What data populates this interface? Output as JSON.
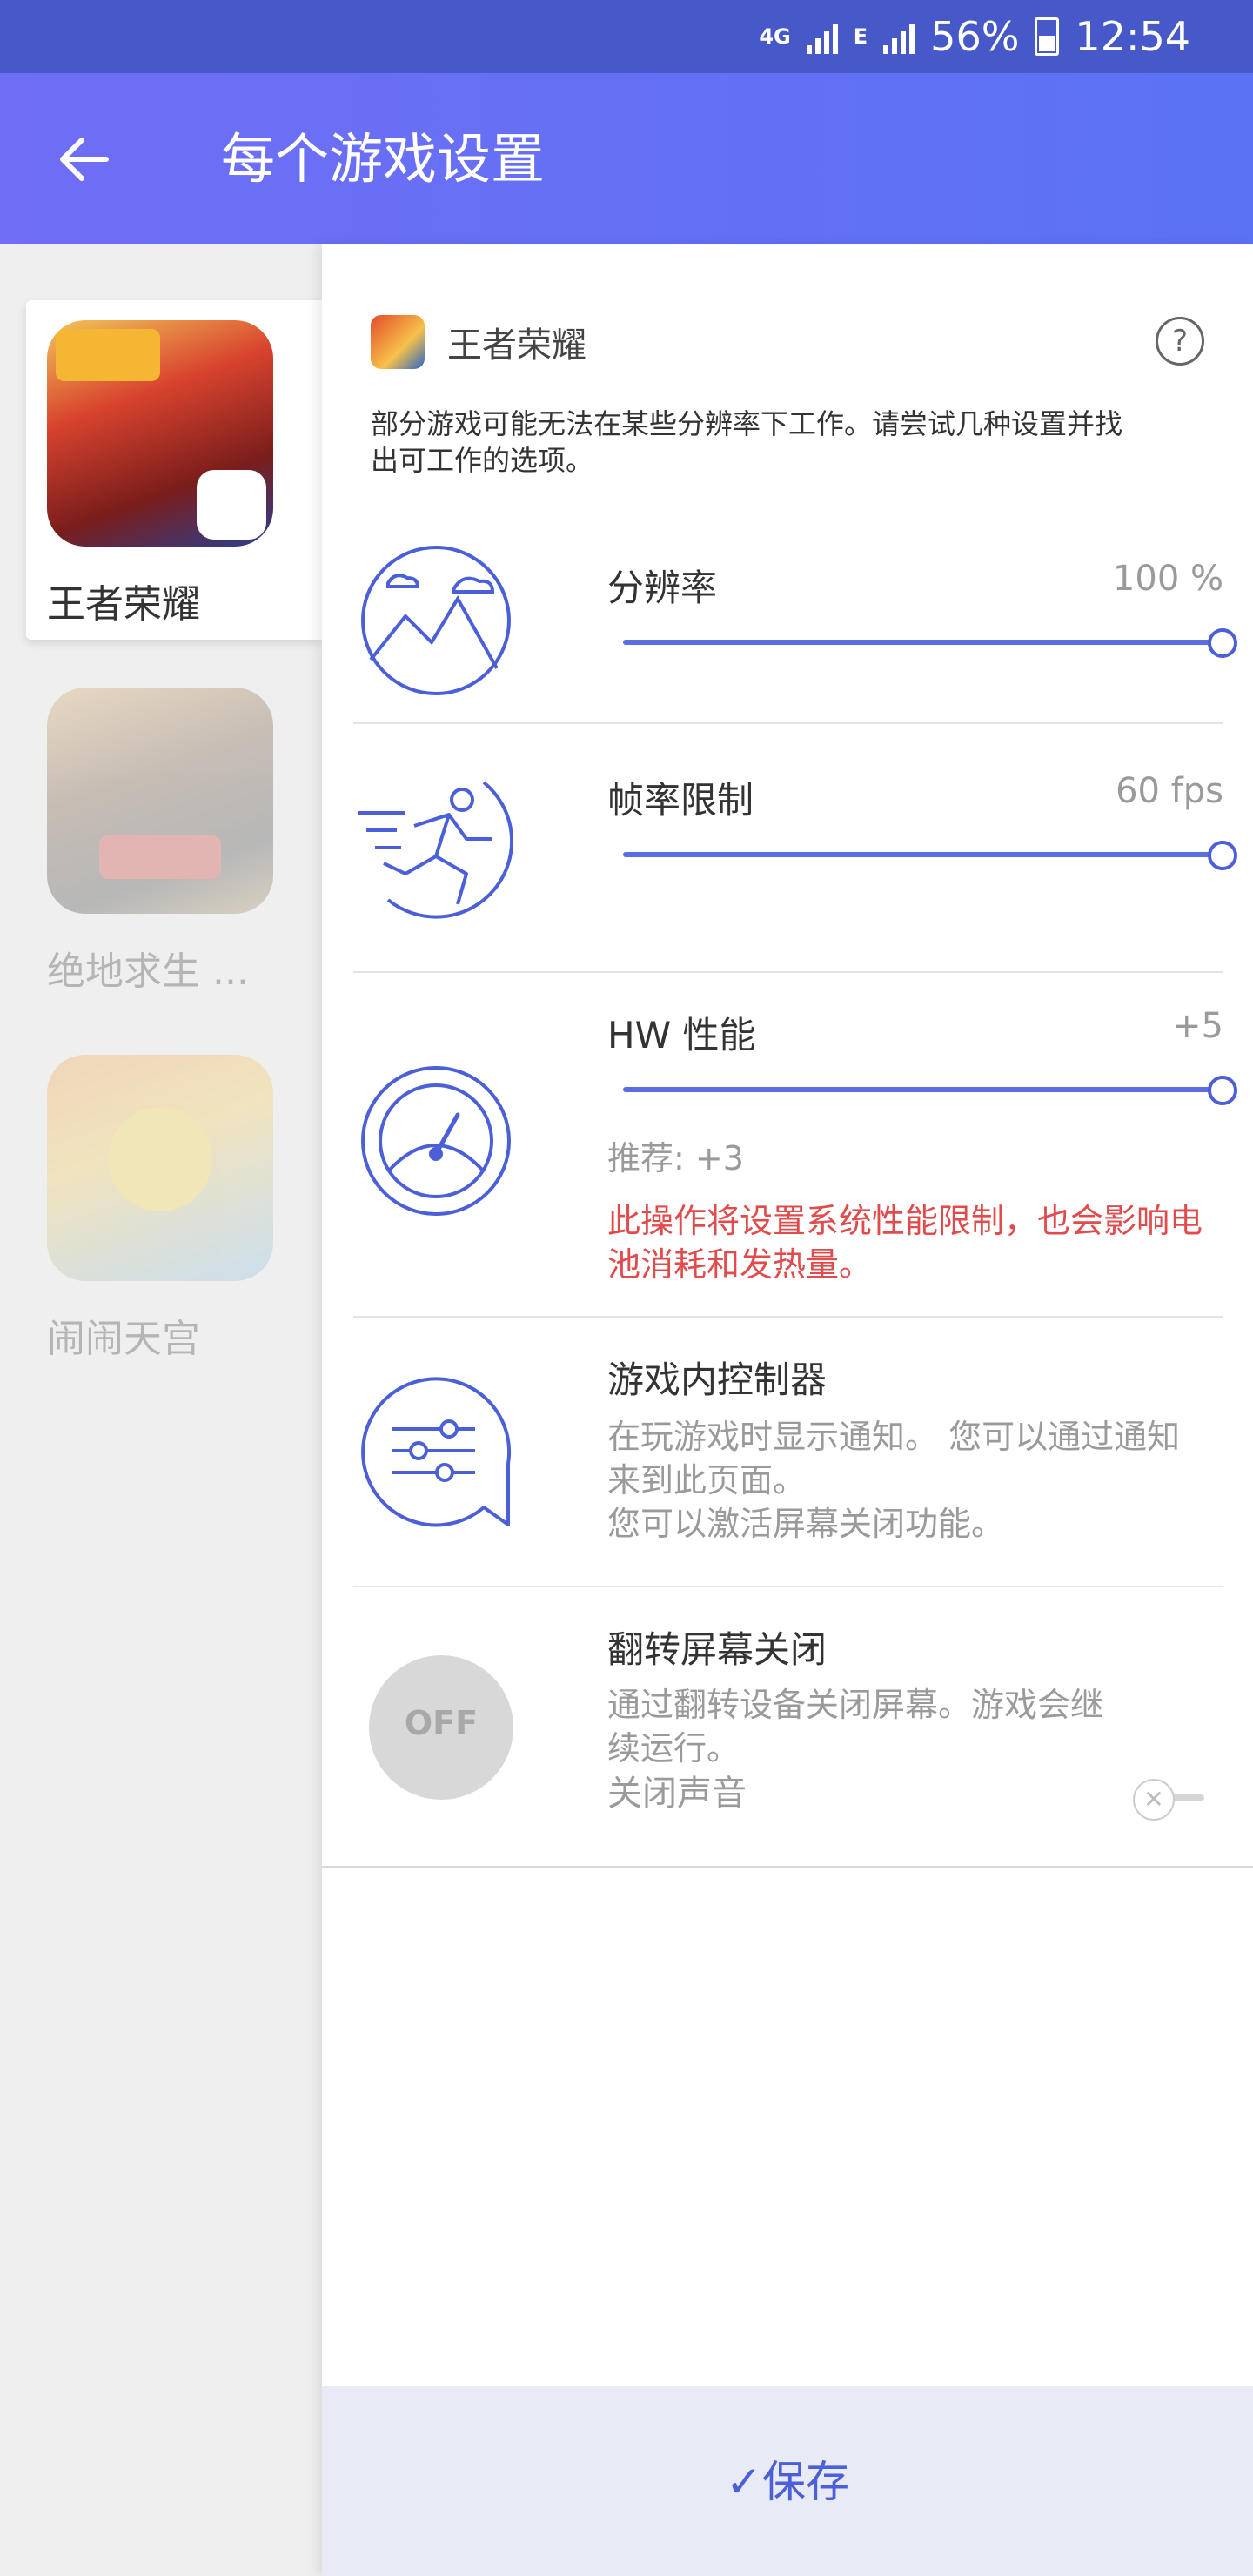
{
  "status_bar": {
    "network": "4G",
    "network2": "E",
    "battery": "56%",
    "time": "12:54"
  },
  "app_bar": {
    "title": "每个游戏设置"
  },
  "games": [
    {
      "name": "王者荣耀"
    },
    {
      "name": "绝地求生 ..."
    },
    {
      "name": "闹闹天宫"
    }
  ],
  "detail": {
    "game_title": "王者荣耀",
    "help": "?",
    "description": "部分游戏可能无法在某些分辨率下工作。请尝试几种设置并找出可工作的选项。",
    "resolution": {
      "label": "分辨率",
      "value": "100 %",
      "level": 1.0
    },
    "frame_rate": {
      "label": "帧率限制",
      "value": "60 fps",
      "level": 1.0
    },
    "hw": {
      "label": "HW 性能",
      "value": "+5",
      "level": 1.0,
      "recommend": "推荐: +3",
      "warning": "此操作将设置系统性能限制，也会影响电池消耗和发热量。"
    },
    "controller": {
      "label": "游戏内控制器",
      "line1": "在玩游戏时显示通知。 您可以通过通知来到此页面。",
      "line2": "您可以激活屏幕关闭功能。"
    },
    "flip": {
      "label": "翻转屏幕关闭",
      "desc": "通过翻转设备关闭屏幕。游戏会继续运行。",
      "mute": "关闭声音",
      "badge": "OFF"
    }
  },
  "footer": {
    "save": "保存"
  },
  "colors": {
    "accent": "#5b6ee0",
    "warning": "#e04b4b",
    "status_bar": "#4758c9"
  }
}
